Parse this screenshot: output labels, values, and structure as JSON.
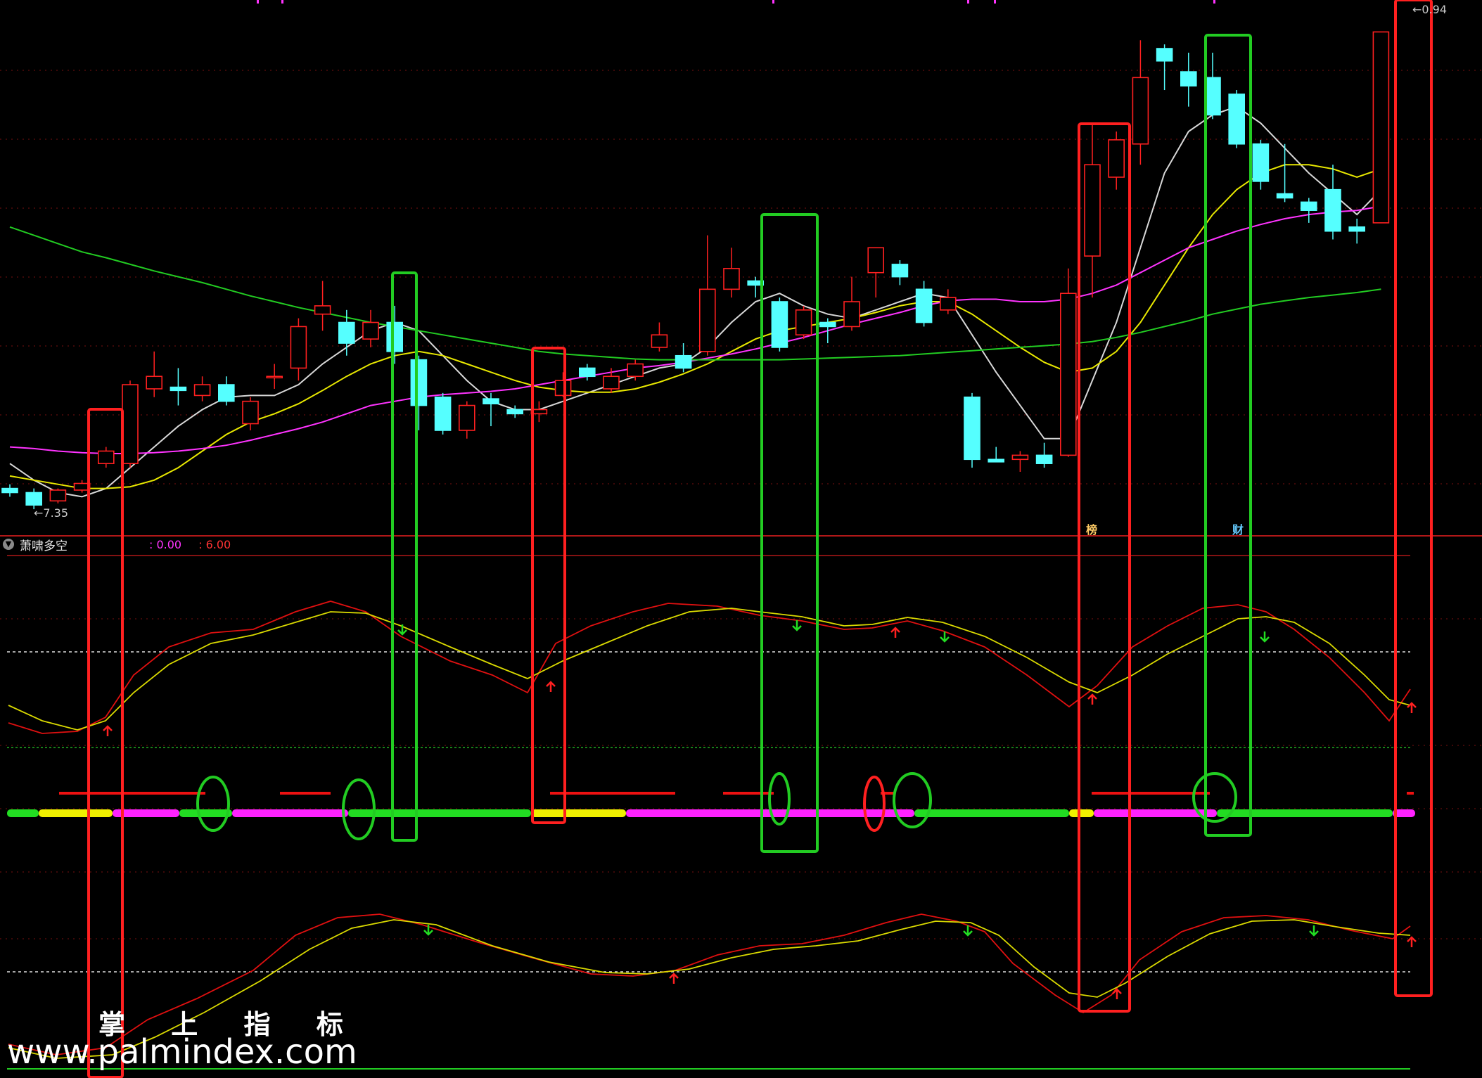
{
  "price_labels": {
    "high": "0.94",
    "low": "7.35"
  },
  "indicator": {
    "name": "萧啸多空",
    "param1": ": 0.00",
    "param2": ": 6.00"
  },
  "tags": {
    "bang": "榜",
    "cai": "财"
  },
  "watermark": {
    "cn": "掌 上 指 标",
    "url": "www.palmindex.com"
  },
  "colors": {
    "background": "#000000",
    "up": "#ff2020",
    "down": "#55ffff",
    "ma5": "#d8d8d8",
    "ma10": "#e8e800",
    "ma20": "#ff33ff",
    "ma60": "#22cc22",
    "buy_box": "#ff2020",
    "sell_box": "#22cc22"
  },
  "chart_data": {
    "type": "candlestick",
    "candles": [
      {
        "o": 7.6,
        "c": 7.55,
        "h": 7.65,
        "l": 7.5
      },
      {
        "o": 7.55,
        "c": 7.4,
        "h": 7.6,
        "l": 7.35
      },
      {
        "o": 7.45,
        "c": 7.58,
        "h": 7.6,
        "l": 7.42
      },
      {
        "o": 7.58,
        "c": 7.66,
        "h": 7.7,
        "l": 7.55
      },
      {
        "o": 7.9,
        "c": 8.05,
        "h": 8.1,
        "l": 7.85
      },
      {
        "o": 7.9,
        "c": 8.85,
        "h": 8.9,
        "l": 7.85
      },
      {
        "o": 8.8,
        "c": 8.95,
        "h": 9.25,
        "l": 8.7
      },
      {
        "o": 8.82,
        "c": 8.78,
        "h": 9.05,
        "l": 8.6
      },
      {
        "o": 8.72,
        "c": 8.85,
        "h": 8.95,
        "l": 8.65
      },
      {
        "o": 8.85,
        "c": 8.65,
        "h": 8.95,
        "l": 8.6
      },
      {
        "o": 8.38,
        "c": 8.65,
        "h": 8.7,
        "l": 8.3
      },
      {
        "o": 8.95,
        "c": 8.95,
        "h": 9.1,
        "l": 8.8
      },
      {
        "o": 9.05,
        "c": 9.55,
        "h": 9.65,
        "l": 8.9
      },
      {
        "o": 9.7,
        "c": 9.8,
        "h": 10.1,
        "l": 9.5
      },
      {
        "o": 9.6,
        "c": 9.35,
        "h": 9.75,
        "l": 9.2
      },
      {
        "o": 9.4,
        "c": 9.6,
        "h": 9.75,
        "l": 9.3
      },
      {
        "o": 9.6,
        "c": 9.25,
        "h": 9.8,
        "l": 9.1
      },
      {
        "o": 9.15,
        "c": 8.6,
        "h": 9.2,
        "l": 8.3
      },
      {
        "o": 8.7,
        "c": 8.3,
        "h": 8.75,
        "l": 8.25
      },
      {
        "o": 8.3,
        "c": 8.6,
        "h": 8.65,
        "l": 8.2
      },
      {
        "o": 8.68,
        "c": 8.62,
        "h": 8.75,
        "l": 8.35
      },
      {
        "o": 8.55,
        "c": 8.5,
        "h": 8.6,
        "l": 8.45
      },
      {
        "o": 8.5,
        "c": 8.55,
        "h": 8.65,
        "l": 8.4
      },
      {
        "o": 8.72,
        "c": 8.9,
        "h": 9.0,
        "l": 8.7
      },
      {
        "o": 9.05,
        "c": 8.95,
        "h": 9.1,
        "l": 8.9
      },
      {
        "o": 8.8,
        "c": 8.95,
        "h": 9.05,
        "l": 8.75
      },
      {
        "o": 8.95,
        "c": 9.1,
        "h": 9.15,
        "l": 8.9
      },
      {
        "o": 9.3,
        "c": 9.45,
        "h": 9.6,
        "l": 9.25
      },
      {
        "o": 9.2,
        "c": 9.05,
        "h": 9.35,
        "l": 9.0
      },
      {
        "o": 9.25,
        "c": 10.0,
        "h": 10.65,
        "l": 9.2
      },
      {
        "o": 10.0,
        "c": 10.25,
        "h": 10.5,
        "l": 9.9
      },
      {
        "o": 10.1,
        "c": 10.05,
        "h": 10.15,
        "l": 9.9
      },
      {
        "o": 9.85,
        "c": 9.3,
        "h": 9.9,
        "l": 9.25
      },
      {
        "o": 9.45,
        "c": 9.75,
        "h": 9.8,
        "l": 9.4
      },
      {
        "o": 9.6,
        "c": 9.55,
        "h": 9.65,
        "l": 9.35
      },
      {
        "o": 9.55,
        "c": 9.85,
        "h": 10.15,
        "l": 9.5
      },
      {
        "o": 10.2,
        "c": 10.5,
        "h": 10.5,
        "l": 9.9
      },
      {
        "o": 10.3,
        "c": 10.15,
        "h": 10.35,
        "l": 10.05
      },
      {
        "o": 10.0,
        "c": 9.6,
        "h": 10.1,
        "l": 9.55
      },
      {
        "o": 9.75,
        "c": 9.9,
        "h": 10.0,
        "l": 9.7
      },
      {
        "o": 8.7,
        "c": 7.95,
        "h": 8.75,
        "l": 7.85
      },
      {
        "o": 7.95,
        "c": 7.92,
        "h": 8.1,
        "l": 7.92
      },
      {
        "o": 7.95,
        "c": 8.0,
        "h": 8.05,
        "l": 7.8
      },
      {
        "o": 8.0,
        "c": 7.9,
        "h": 8.15,
        "l": 7.85
      },
      {
        "o": 8.0,
        "c": 9.95,
        "h": 10.25,
        "l": 7.98
      },
      {
        "o": 10.4,
        "c": 11.5,
        "h": 12.0,
        "l": 9.9
      },
      {
        "o": 11.35,
        "c": 11.8,
        "h": 11.9,
        "l": 11.2
      },
      {
        "o": 11.75,
        "c": 12.55,
        "h": 13.0,
        "l": 11.5
      },
      {
        "o": 12.9,
        "c": 12.75,
        "h": 12.95,
        "l": 12.4
      },
      {
        "o": 12.62,
        "c": 12.45,
        "h": 12.85,
        "l": 12.2
      },
      {
        "o": 12.55,
        "c": 12.1,
        "h": 12.85,
        "l": 12.05
      },
      {
        "o": 12.35,
        "c": 11.75,
        "h": 12.4,
        "l": 11.7
      },
      {
        "o": 11.75,
        "c": 11.3,
        "h": 11.8,
        "l": 11.2
      },
      {
        "o": 11.15,
        "c": 11.1,
        "h": 11.75,
        "l": 11.05
      },
      {
        "o": 11.05,
        "c": 10.95,
        "h": 11.1,
        "l": 10.8
      },
      {
        "o": 11.2,
        "c": 10.7,
        "h": 11.5,
        "l": 10.6
      },
      {
        "o": 10.75,
        "c": 10.7,
        "h": 10.85,
        "l": 10.55
      },
      {
        "o": 10.8,
        "c": 13.1,
        "h": 13.1,
        "l": 10.8
      }
    ],
    "moving_averages": {
      "ma5": [
        7.9,
        7.7,
        7.55,
        7.5,
        7.6,
        7.85,
        8.1,
        8.35,
        8.55,
        8.7,
        8.72,
        8.72,
        8.85,
        9.1,
        9.3,
        9.5,
        9.6,
        9.5,
        9.2,
        8.9,
        8.65,
        8.55,
        8.55,
        8.65,
        8.75,
        8.85,
        8.95,
        9.05,
        9.1,
        9.3,
        9.6,
        9.85,
        9.95,
        9.8,
        9.7,
        9.65,
        9.75,
        9.85,
        9.95,
        9.9,
        9.45,
        9.0,
        8.6,
        8.2,
        8.2,
        8.9,
        9.6,
        10.5,
        11.4,
        11.9,
        12.1,
        12.2,
        12.0,
        11.7,
        11.4,
        11.15,
        10.9,
        11.2
      ],
      "ma10": [
        7.75,
        7.7,
        7.65,
        7.6,
        7.6,
        7.62,
        7.7,
        7.85,
        8.05,
        8.25,
        8.4,
        8.5,
        8.62,
        8.78,
        8.95,
        9.1,
        9.2,
        9.25,
        9.2,
        9.1,
        9.0,
        8.9,
        8.82,
        8.78,
        8.76,
        8.76,
        8.8,
        8.88,
        8.98,
        9.1,
        9.25,
        9.4,
        9.5,
        9.55,
        9.6,
        9.65,
        9.72,
        9.8,
        9.85,
        9.85,
        9.7,
        9.5,
        9.3,
        9.12,
        9.0,
        9.05,
        9.25,
        9.6,
        10.05,
        10.5,
        10.9,
        11.2,
        11.4,
        11.5,
        11.5,
        11.45,
        11.35,
        11.45
      ],
      "ma20": [
        8.1,
        8.08,
        8.05,
        8.03,
        8.02,
        8.02,
        8.03,
        8.05,
        8.08,
        8.12,
        8.18,
        8.25,
        8.32,
        8.4,
        8.5,
        8.6,
        8.65,
        8.7,
        8.73,
        8.75,
        8.77,
        8.8,
        8.85,
        8.9,
        8.95,
        9.0,
        9.05,
        9.08,
        9.12,
        9.17,
        9.22,
        9.28,
        9.35,
        9.42,
        9.5,
        9.58,
        9.65,
        9.72,
        9.8,
        9.86,
        9.88,
        9.88,
        9.85,
        9.85,
        9.88,
        9.95,
        10.05,
        10.2,
        10.35,
        10.5,
        10.6,
        10.7,
        10.78,
        10.85,
        10.9,
        10.93,
        10.95,
        11.0
      ],
      "ma60": [
        10.75,
        10.65,
        10.55,
        10.45,
        10.38,
        10.3,
        10.22,
        10.15,
        10.08,
        10.0,
        9.92,
        9.85,
        9.78,
        9.72,
        9.66,
        9.6,
        9.55,
        9.5,
        9.45,
        9.4,
        9.35,
        9.3,
        9.25,
        9.22,
        9.2,
        9.18,
        9.16,
        9.15,
        9.15,
        9.15,
        9.15,
        9.15,
        9.15,
        9.16,
        9.17,
        9.18,
        9.19,
        9.2,
        9.22,
        9.24,
        9.26,
        9.28,
        9.3,
        9.32,
        9.34,
        9.37,
        9.42,
        9.48,
        9.55,
        9.62,
        9.7,
        9.76,
        9.82,
        9.86,
        9.9,
        9.93,
        9.96,
        10.0
      ]
    }
  }
}
